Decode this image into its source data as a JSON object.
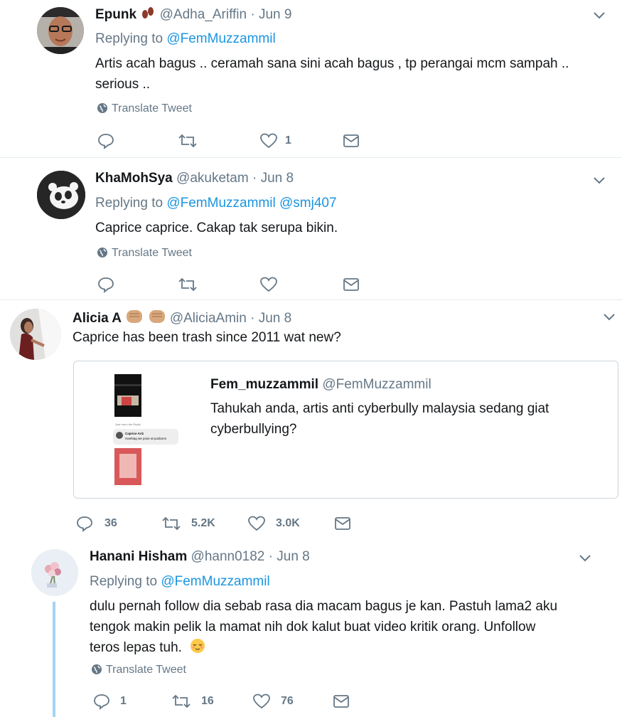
{
  "tweets": [
    {
      "name": "Epunk",
      "emoji": "footprints-emoji",
      "handle": "@Adha_Ariffin",
      "date": "Jun 9",
      "replying_prefix": "Replying to",
      "replying_to": "@FemMuzzammil",
      "text_line1": "Artis acah bagus .. ceramah sana sini acah bagus , tp perangai mcm sampah ..",
      "text_line2": "serious ..",
      "translate": "Translate Tweet",
      "likes": "1"
    },
    {
      "name": "KhaMohSya",
      "handle": "@akuketam",
      "date": "Jun 8",
      "replying_prefix": "Replying to",
      "replying_to": "@FemMuzzammil",
      "replying_to_2": "@smj407",
      "text": "Caprice caprice. Cakap tak serupa bikin.",
      "translate": "Translate Tweet"
    },
    {
      "name": "Alicia A",
      "emoji": "fist-emoji",
      "handle": "@AliciaAmin",
      "date": "Jun 8",
      "text": "Caprice has been trash since 2011 wat new?",
      "quote": {
        "name": "Fem_muzzammil",
        "handle": "@FemMuzzammil",
        "text_line1": "Tahukah anda, artis anti cyberbully malaysia sedang giat",
        "text_line2": "cyberbullying?",
        "thumb_small_1": "Just now    Like    Reply",
        "thumb_small_2": "Caprice Ariz",
        "thumb_small_3": "Hashtag we pose at podiums"
      },
      "replies": "36",
      "retweets": "5.2K",
      "likes": "3.0K"
    },
    {
      "name": "Hanani Hisham",
      "handle": "@hann0182",
      "date": "Jun 8",
      "replying_prefix": "Replying to",
      "replying_to": "@FemMuzzammil",
      "text_line1": "dulu pernah follow dia sebab rasa dia macam bagus je kan. Pastuh lama2 aku",
      "text_line2": "tengok makin pelik la mamat nih dok kalut buat video kritik orang. Unfollow",
      "text_line3": "teros lepas tuh.",
      "emoji": "relieved-face-emoji",
      "translate": "Translate Tweet",
      "replies": "1",
      "retweets": "16",
      "likes": "76"
    }
  ],
  "colors": {
    "text": "#14171a",
    "muted": "#657786",
    "link": "#1b95e0",
    "border": "#e6ecf0",
    "thread": "#a3d3f5"
  }
}
